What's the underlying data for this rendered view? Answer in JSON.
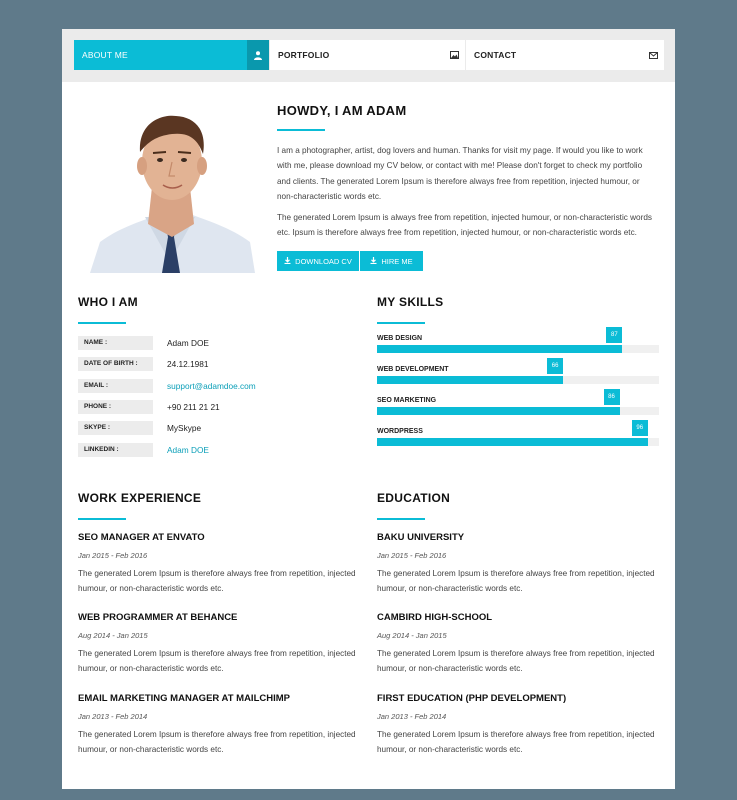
{
  "nav": {
    "tabs": [
      {
        "label": "ABOUT ME",
        "icon": "user-icon"
      },
      {
        "label": "PORTFOLIO",
        "icon": "image-icon"
      },
      {
        "label": "CONTACT",
        "icon": "envelope-icon"
      }
    ]
  },
  "profile": {
    "heading": "HOWDY, I AM ADAM",
    "para1": "I am a photographer, artist, dog lovers and human. Thanks for visit my page. If would you like to work with me, please download my CV below, or contact with me! Please don't forget to check my portfolio and clients. The generated Lorem Ipsum is therefore always free from repetition, injected humour, or non-characteristic words etc.",
    "para2": "The generated Lorem Ipsum is always free from repetition, injected humour, or non-characteristic words etc. Ipsum is therefore always free from repetition, injected humour, or non-characteristic words etc.",
    "download_label": "DOWNLOAD CV",
    "hire_label": "HIRE ME"
  },
  "who": {
    "title": "WHO I AM",
    "rows": [
      {
        "key": "NAME :",
        "value": "Adam DOE"
      },
      {
        "key": "DATE OF BIRTH :",
        "value": "24.12.1981"
      },
      {
        "key": "EMAIL :",
        "value": "support@adamdoe.com"
      },
      {
        "key": "PHONE :",
        "value": "+90 211 21 21"
      },
      {
        "key": "SKYPE :",
        "value": "MySkype"
      },
      {
        "key": "LINKEDIN :",
        "value": "Adam DOE"
      }
    ]
  },
  "skills": {
    "title": "MY SKILLS",
    "items": [
      {
        "name": "WEB DESIGN",
        "value": 87,
        "percent": "87"
      },
      {
        "name": "WEB DEVELOPMENT",
        "value": 66,
        "percent": "66"
      },
      {
        "name": "SEO MARKETING",
        "value": 86,
        "percent": "86"
      },
      {
        "name": "WORDPRESS",
        "value": 96,
        "percent": "96"
      }
    ]
  },
  "work": {
    "title": "WORK EXPERIENCE",
    "items": [
      {
        "title": "SEO MANAGER AT ENVATO",
        "date": "Jan 2015 - Feb 2016",
        "desc": "The generated Lorem Ipsum is therefore always free from repetition, injected humour, or non-characteristic words etc."
      },
      {
        "title": "WEB PROGRAMMER AT BEHANCE",
        "date": "Aug 2014 - Jan 2015",
        "desc": "The generated Lorem Ipsum is therefore always free from repetition, injected humour, or non-characteristic words etc."
      },
      {
        "title": "EMAIL MARKETING MANAGER AT MAILCHIMP",
        "date": "Jan 2013 - Feb 2014",
        "desc": "The generated Lorem Ipsum is therefore always free from repetition, injected humour, or non-characteristic words etc."
      }
    ]
  },
  "education": {
    "title": "EDUCATION",
    "items": [
      {
        "title": "BAKU UNIVERSITY",
        "date": "Jan 2015 - Feb 2016",
        "desc": "The generated Lorem Ipsum is therefore always free from repetition, injected humour, or non-characteristic words etc."
      },
      {
        "title": "CAMBIRD HIGH-SCHOOL",
        "date": "Aug 2014 - Jan 2015",
        "desc": "The generated Lorem Ipsum is therefore always free from repetition, injected humour, or non-characteristic words etc."
      },
      {
        "title": "FIRST EDUCATION (PHP DEVELOPMENT)",
        "date": "Jan 2013 - Feb 2014",
        "desc": "The generated Lorem Ipsum is therefore always free from repetition, injected humour, or non-characteristic words etc."
      }
    ]
  },
  "colors": {
    "accent": "#0bbcd6",
    "accent_dark": "#0a98ad",
    "background": "#5f7a8a"
  }
}
